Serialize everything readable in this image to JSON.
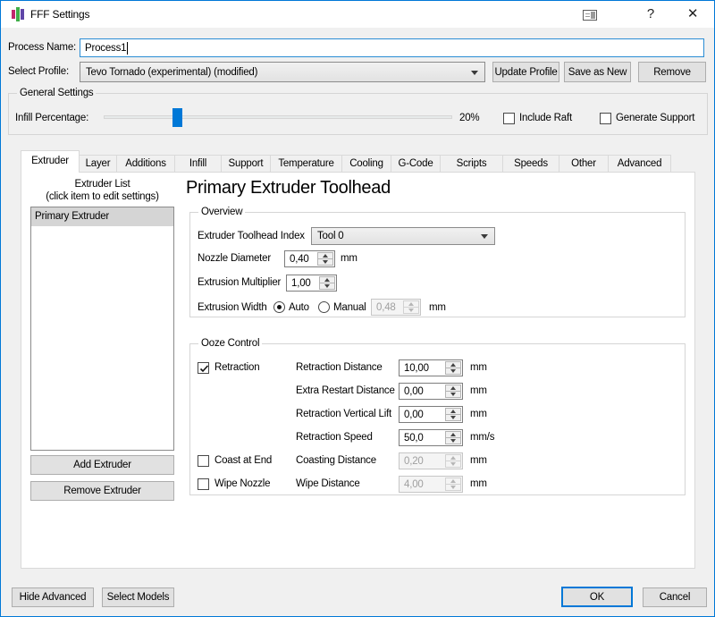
{
  "colors": {
    "accent": "#0078d7",
    "dialog_bg": "#f0f0f0",
    "titlebar_bg": "#ffffff",
    "selection_bg": "#d5d5d5"
  },
  "window": {
    "title": "FFF Settings",
    "help_label": "?",
    "close_label": "✕"
  },
  "process": {
    "label": "Process Name:",
    "value": "Process1"
  },
  "profile": {
    "label": "Select Profile:",
    "value": "Tevo Tornado (experimental) (modified)",
    "update_button": "Update Profile",
    "save_button": "Save as New",
    "remove_button": "Remove"
  },
  "general": {
    "title": "General Settings",
    "infill_label": "Infill Percentage:",
    "infill_value": "20%",
    "infill_percent": 20,
    "include_raft": {
      "label": "Include Raft",
      "checked": false
    },
    "generate_support": {
      "label": "Generate Support",
      "checked": false
    }
  },
  "tabs": {
    "active": "Extruder",
    "items": [
      "Extruder",
      "Layer",
      "Additions",
      "Infill",
      "Support",
      "Temperature",
      "Cooling",
      "G-Code",
      "Scripts",
      "Speeds",
      "Other",
      "Advanced"
    ]
  },
  "extruder_tab": {
    "list_title": "Extruder List",
    "list_subtitle": "(click item to edit settings)",
    "list_items": [
      "Primary Extruder"
    ],
    "add_button": "Add Extruder",
    "remove_button": "Remove Extruder",
    "heading": "Primary Extruder Toolhead",
    "overview": {
      "title": "Overview",
      "toolhead_label": "Extruder Toolhead Index",
      "toolhead_value": "Tool 0",
      "nozzle_label": "Nozzle Diameter",
      "nozzle_value": "0,40",
      "nozzle_unit": "mm",
      "multiplier_label": "Extrusion Multiplier",
      "multiplier_value": "1,00",
      "width_label": "Extrusion Width",
      "width_auto_label": "Auto",
      "width_manual_label": "Manual",
      "width_selected": "Auto",
      "width_value": "0,48",
      "width_unit": "mm"
    },
    "ooze": {
      "title": "Ooze Control",
      "retraction": {
        "label": "Retraction",
        "checked": true
      },
      "coast": {
        "label": "Coast at End",
        "checked": false
      },
      "wipe": {
        "label": "Wipe Nozzle",
        "checked": false
      },
      "rows": [
        {
          "label": "Retraction Distance",
          "value": "10,00",
          "unit": "mm",
          "enabled": true
        },
        {
          "label": "Extra Restart Distance",
          "value": "0,00",
          "unit": "mm",
          "enabled": true
        },
        {
          "label": "Retraction Vertical Lift",
          "value": "0,00",
          "unit": "mm",
          "enabled": true
        },
        {
          "label": "Retraction Speed",
          "value": "50,0",
          "unit": "mm/s",
          "enabled": true
        },
        {
          "label": "Coasting Distance",
          "value": "0,20",
          "unit": "mm",
          "enabled": false
        },
        {
          "label": "Wipe Distance",
          "value": "4,00",
          "unit": "mm",
          "enabled": false
        }
      ]
    }
  },
  "footer": {
    "hide_advanced_button": "Hide Advanced",
    "select_models_button": "Select Models",
    "ok_button": "OK",
    "cancel_button": "Cancel"
  }
}
